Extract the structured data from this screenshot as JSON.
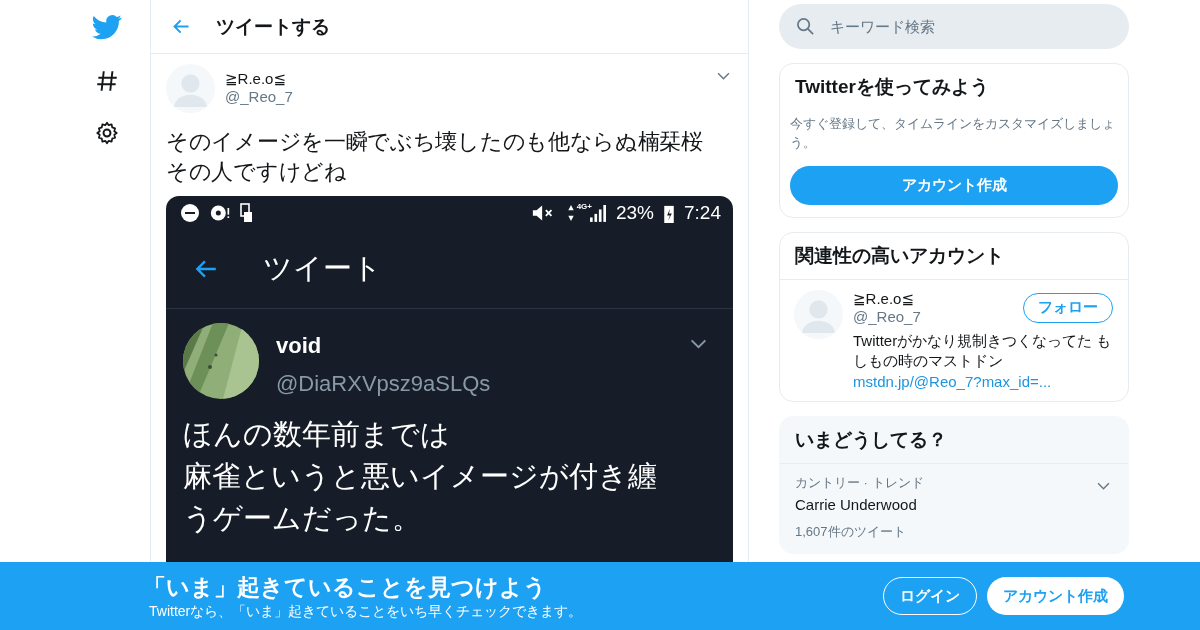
{
  "header": {
    "title": "ツイートする"
  },
  "tweet": {
    "name": "≧R.e.o≦",
    "handle": "@_Reo_7",
    "lines": [
      "そのイメージを一瞬でぶち壊したのも他ならぬ楠栞桜",
      "その人ですけどね"
    ],
    "screenshot": {
      "status_bar": {
        "network": "4G+",
        "battery": "23%",
        "time": "7:24"
      },
      "title": "ツイート",
      "name": "void",
      "handle": "@DiaRXVpsz9aSLQs",
      "lines": [
        "ほんの数年前までは",
        "麻雀というと悪いイメージが付き纏",
        "うゲームだった。"
      ]
    }
  },
  "search": {
    "placeholder": "キーワード検索"
  },
  "signup": {
    "title": "Twitterを使ってみよう",
    "text": "今すぐ登録して、タイムラインをカスタマイズしましょう。",
    "button": "アカウント作成"
  },
  "related": {
    "title": "関連性の高いアカウント",
    "accounts": [
      {
        "name": "≧R.e.o≦",
        "handle": "@_Reo_7",
        "follow": "フォロー",
        "bio": "Twitterがかなり規制きつくなってた もしもの時のマストドン",
        "link": "mstdn.jp/@Reo_7?max_id=..."
      }
    ]
  },
  "trends": {
    "title": "いまどうしてる？",
    "items": [
      {
        "context": "カントリー · トレンド",
        "name": "Carrie Underwood",
        "count": "1,607件のツイート"
      }
    ]
  },
  "banner": {
    "title": "「いま」起きていることを見つけよう",
    "text": "Twitterなら、「いま」起きていることをいち早くチェックできます。",
    "login": "ログイン",
    "signup": "アカウント作成"
  }
}
